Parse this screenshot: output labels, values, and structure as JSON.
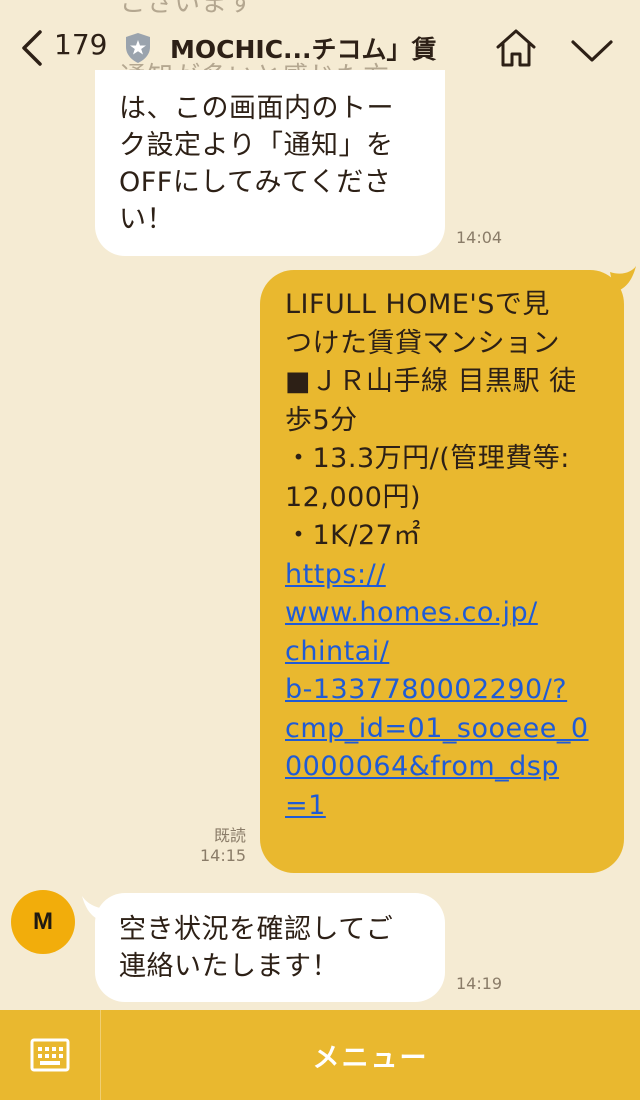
{
  "header": {
    "back_count": "179",
    "title": "MOCHIC...チコム」賃",
    "ghost_top": "ございます",
    "ghost_behind": "通知が多いと感じた方"
  },
  "messages": [
    {
      "side": "in",
      "lines": [
        "は、この画面内のトー",
        "ク設定より「通知」を",
        "OFFにしてみてくださ",
        "い！"
      ],
      "time": "14:04"
    },
    {
      "side": "out",
      "lines": [
        "LIFULL HOME'Sで見",
        "つけた賃貸マンション",
        "■ＪＲ山手線 目黒駅 徒",
        "歩5分",
        "・13.3万円/(管理費等:",
        "12,000円)",
        "・1K/27㎡"
      ],
      "link_lines": [
        "https://",
        "www.homes.co.jp/",
        "chintai/",
        "b-1337780002290/?",
        "cmp_id=01_sooeee_0",
        "0000064&from_dsp",
        "=1"
      ],
      "read": "既読",
      "time": "14:15"
    },
    {
      "side": "in",
      "avatar": "M",
      "lines": [
        "空き状況を確認してご",
        "連絡いたします！"
      ],
      "time": "14:19"
    }
  ],
  "footer": {
    "menu_label": "メニュー",
    "keyboard_icon": "keyboard-icon"
  },
  "colors": {
    "background": "#f5ebd3",
    "outgoing_bubble": "#e9b82f",
    "incoming_bubble": "#ffffff",
    "footer": "#e9b82f",
    "link": "#1f5bd6",
    "avatar": "#f2ad0b"
  }
}
